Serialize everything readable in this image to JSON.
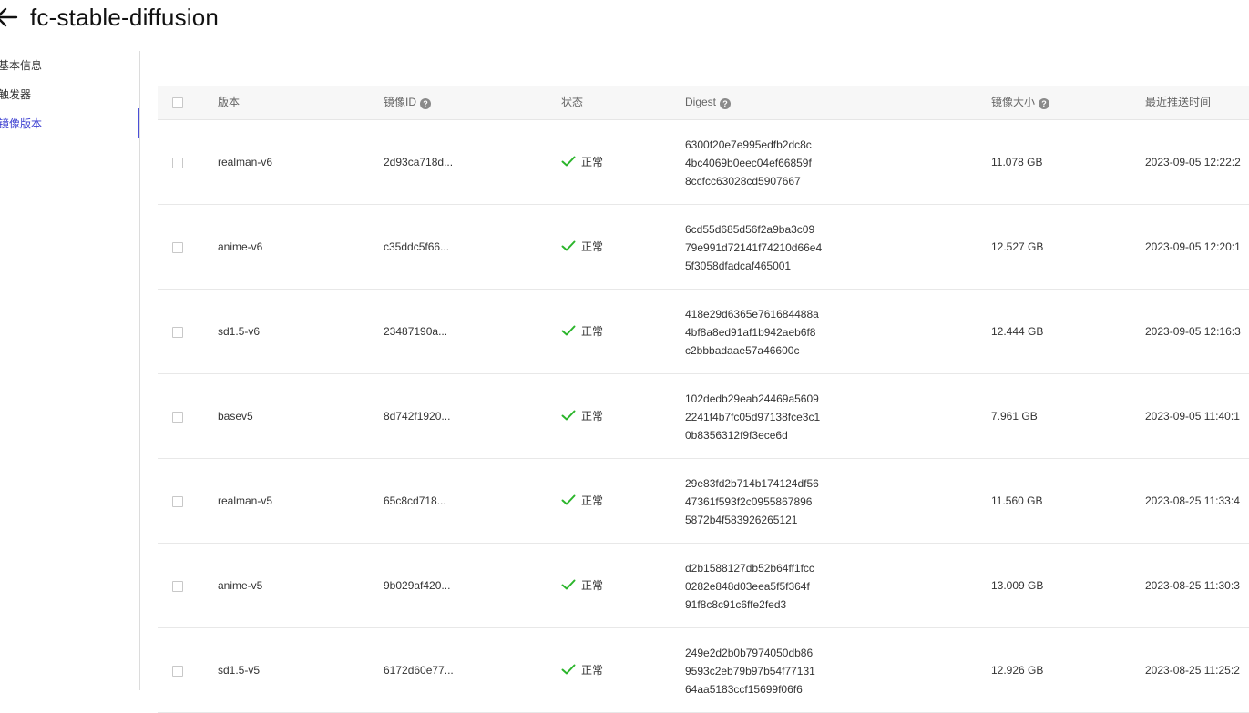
{
  "header": {
    "title": "fc-stable-diffusion"
  },
  "sidebar": {
    "items": [
      {
        "label": "基本信息",
        "active": false
      },
      {
        "label": "触发器",
        "active": false
      },
      {
        "label": "镜像版本",
        "active": true
      }
    ]
  },
  "table": {
    "headers": {
      "version": "版本",
      "image_id": "镜像ID",
      "status": "状态",
      "digest": "Digest",
      "size": "镜像大小",
      "pushed_at": "最近推送时间"
    },
    "rows": [
      {
        "version": "realman-v6",
        "image_id": "2d93ca718d...",
        "status": "正常",
        "digest": [
          "6300f20e7e995edfb2dc8c",
          "4bc4069b0eec04ef66859f",
          "8ccfcc63028cd5907667"
        ],
        "size": "11.078 GB",
        "pushed_at": "2023-09-05 12:22:2"
      },
      {
        "version": "anime-v6",
        "image_id": "c35ddc5f66...",
        "status": "正常",
        "digest": [
          "6cd55d685d56f2a9ba3c09",
          "79e991d72141f74210d66e4",
          "5f3058dfadcaf465001"
        ],
        "size": "12.527 GB",
        "pushed_at": "2023-09-05 12:20:1"
      },
      {
        "version": "sd1.5-v6",
        "image_id": "23487190a...",
        "status": "正常",
        "digest": [
          "418e29d6365e761684488a",
          "4bf8a8ed91af1b942aeb6f8",
          "c2bbbadaae57a46600c"
        ],
        "size": "12.444 GB",
        "pushed_at": "2023-09-05 12:16:3"
      },
      {
        "version": "basev5",
        "image_id": "8d742f1920...",
        "status": "正常",
        "digest": [
          "102dedb29eab24469a5609",
          "2241f4b7fc05d97138fce3c1",
          "0b8356312f9f3ece6d"
        ],
        "size": "7.961 GB",
        "pushed_at": "2023-09-05 11:40:1"
      },
      {
        "version": "realman-v5",
        "image_id": "65c8cd718...",
        "status": "正常",
        "digest": [
          "29e83fd2b714b174124df56",
          "47361f593f2c0955867896",
          "5872b4f583926265121"
        ],
        "size": "11.560 GB",
        "pushed_at": "2023-08-25 11:33:4"
      },
      {
        "version": "anime-v5",
        "image_id": "9b029af420...",
        "status": "正常",
        "digest": [
          "d2b1588127db52b64ff1fcc",
          "0282e848d03eea5f5f364f",
          "91f8c8c91c6ffe2fed3"
        ],
        "size": "13.009 GB",
        "pushed_at": "2023-08-25 11:30:3"
      },
      {
        "version": "sd1.5-v5",
        "image_id": "6172d60e77...",
        "status": "正常",
        "digest": [
          "249e2d2b0b7974050db86",
          "9593c2eb79b97b54f77131",
          "64aa5183ccf15699f06f6"
        ],
        "size": "12.926 GB",
        "pushed_at": "2023-08-25 11:25:2"
      }
    ]
  },
  "icons": {
    "back": "arrow-left-icon",
    "help": "question-circle-icon",
    "status": "check-icon"
  },
  "colors": {
    "accent": "#3b3ed1",
    "success": "#2bb52b",
    "header_bg": "#f7f7f7"
  }
}
